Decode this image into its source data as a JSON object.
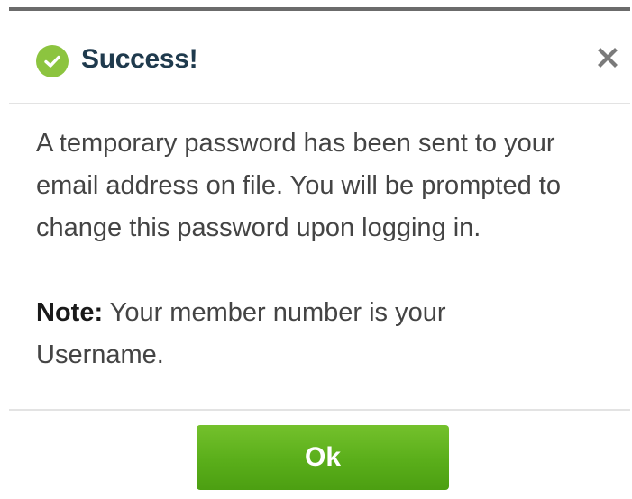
{
  "dialog": {
    "title": "Success!",
    "close_icon": "close-icon",
    "success_icon": "check-circle-icon",
    "message": "A temporary password has been sent to your email address on file. You will be prompted to change this password upon logging in.",
    "note_label": "Note:",
    "note_text": " Your member number is your Username.",
    "ok_label": "Ok"
  },
  "colors": {
    "success_green": "#8cc43f",
    "title_navy": "#1f3a4d",
    "button_green": "#5aae1a"
  }
}
